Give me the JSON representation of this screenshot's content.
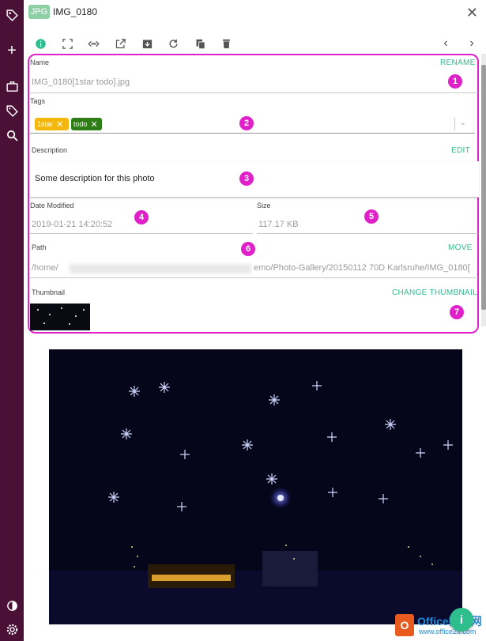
{
  "header": {
    "badge": "JPG",
    "title": "IMG_0180",
    "close_icon": "close-icon"
  },
  "sidebar": {
    "icons": [
      "tag-logo-icon",
      "plus-icon",
      "briefcase-icon",
      "tag-icon",
      "search-icon",
      "contrast-icon",
      "gear-icon"
    ]
  },
  "toolbar": {
    "icons": [
      "info-icon",
      "fullscreen-icon",
      "code-icon",
      "open-external-icon",
      "download-icon",
      "refresh-icon",
      "copy-icon",
      "delete-icon",
      "chevron-left-icon",
      "chevron-right-icon"
    ]
  },
  "properties": {
    "name": {
      "label": "Name",
      "action": "RENAME",
      "value": "IMG_0180[1star todo].jpg"
    },
    "tags": {
      "label": "Tags",
      "items": [
        {
          "label": "1star",
          "color": "#f5b70e"
        },
        {
          "label": "todo",
          "color": "#2e7d16"
        }
      ]
    },
    "description": {
      "label": "Description",
      "action": "EDIT",
      "value": "Some description for this photo"
    },
    "date_modified": {
      "label": "Date Modified",
      "value": "2019-01-21 14:20:52"
    },
    "size": {
      "label": "Size",
      "value": "117.17 KB"
    },
    "path": {
      "label": "Path",
      "action": "MOVE",
      "prefix": "/home/",
      "suffix": "emo/Photo-Gallery/20150112 70D Karlsruhe/IMG_0180["
    },
    "thumbnail": {
      "label": "Thumbnail",
      "action": "CHANGE THUMBNAIL"
    }
  },
  "annotations": [
    "1",
    "2",
    "3",
    "4",
    "5",
    "6",
    "7"
  ],
  "accent_color": "#e020c8",
  "action_color": "#2ebd8c",
  "watermark": {
    "title": "Office教程网",
    "url": "www.office26.com"
  }
}
